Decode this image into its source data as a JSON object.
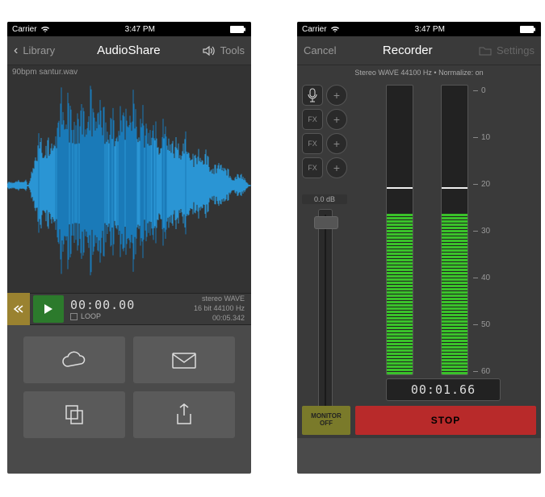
{
  "statusbar": {
    "carrier": "Carrier",
    "time": "3:47 PM"
  },
  "left": {
    "nav": {
      "back": "Library",
      "title": "AudioShare",
      "tools": "Tools"
    },
    "filename": "90bpm santur.wav",
    "transport": {
      "time": "00:00.00",
      "loop": "LOOP"
    },
    "meta": {
      "format": "stereo WAVE",
      "specs": "16 bit 44100 Hz",
      "duration": "00:05.342"
    }
  },
  "right": {
    "nav": {
      "cancel": "Cancel",
      "title": "Recorder",
      "settings": "Settings"
    },
    "info": "Stereo WAVE 44100 Hz • Normalize: on",
    "fx": [
      "FX",
      "FX",
      "FX"
    ],
    "db": "0.0 dB",
    "scale": [
      "0",
      "10",
      "20",
      "30",
      "40",
      "50",
      "60"
    ],
    "timer": "00:01.66",
    "monitor1": "MONITOR",
    "monitor2": "OFF",
    "stop": "STOP"
  }
}
